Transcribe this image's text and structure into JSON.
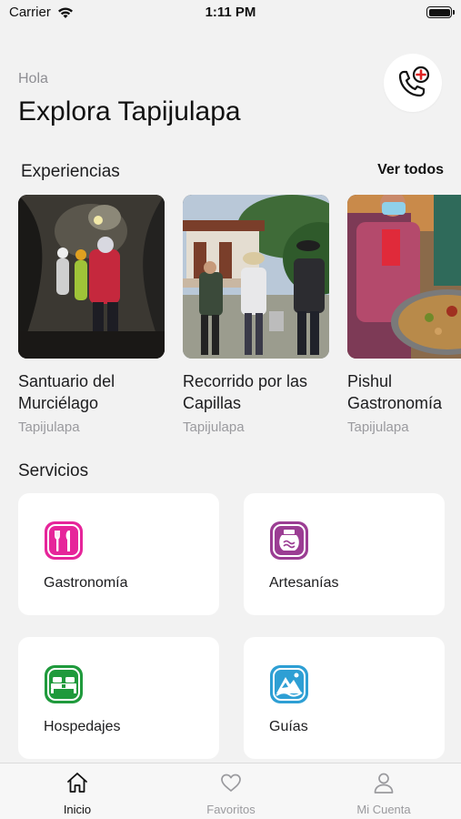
{
  "status_bar": {
    "carrier": "Carrier",
    "time": "1:11 PM"
  },
  "header": {
    "greeting": "Hola",
    "title": "Explora Tapijulapa",
    "emergency_icon": "phone-plus-icon"
  },
  "experiences": {
    "title": "Experiencias",
    "see_all": "Ver todos",
    "items": [
      {
        "name_line1": "Santuario del",
        "name_line2": "Murciélago",
        "location": "Tapijulapa"
      },
      {
        "name_line1": "Recorrido por las",
        "name_line2": "Capillas",
        "location": "Tapijulapa"
      },
      {
        "name_line1": "Pishul",
        "name_line2": "Gastronomía",
        "location": "Tapijulapa"
      }
    ]
  },
  "services": {
    "title": "Servicios",
    "items": [
      {
        "label": "Gastronomía",
        "icon": "utensils-icon",
        "color": "#e6259a"
      },
      {
        "label": "Artesanías",
        "icon": "pottery-icon",
        "color": "#9b3d93"
      },
      {
        "label": "Hospedajes",
        "icon": "beds-icon",
        "color": "#1f9a3c"
      },
      {
        "label": "Guías",
        "icon": "mountain-icon",
        "color": "#2e9fd4"
      }
    ]
  },
  "tab_bar": {
    "tabs": [
      {
        "label": "Inicio",
        "icon": "home-icon",
        "active": true
      },
      {
        "label": "Favoritos",
        "icon": "heart-icon",
        "active": false
      },
      {
        "label": "Mi Cuenta",
        "icon": "user-icon",
        "active": false
      }
    ]
  }
}
